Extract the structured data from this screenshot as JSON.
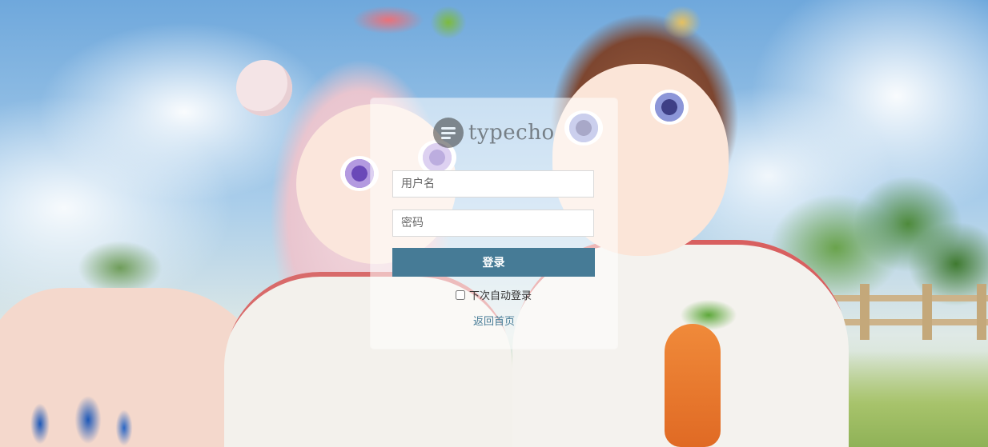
{
  "brand": {
    "name": "typecho",
    "icon": "typecho-logo-icon"
  },
  "login": {
    "username_placeholder": "用户名",
    "password_placeholder": "密码",
    "submit_label": "登录",
    "remember_label": "下次自动登录",
    "remember_checked": false,
    "back_link_label": "返回首页"
  },
  "colors": {
    "accent": "#467b96",
    "panel_bg": "rgba(255,255,255,0.55)"
  }
}
